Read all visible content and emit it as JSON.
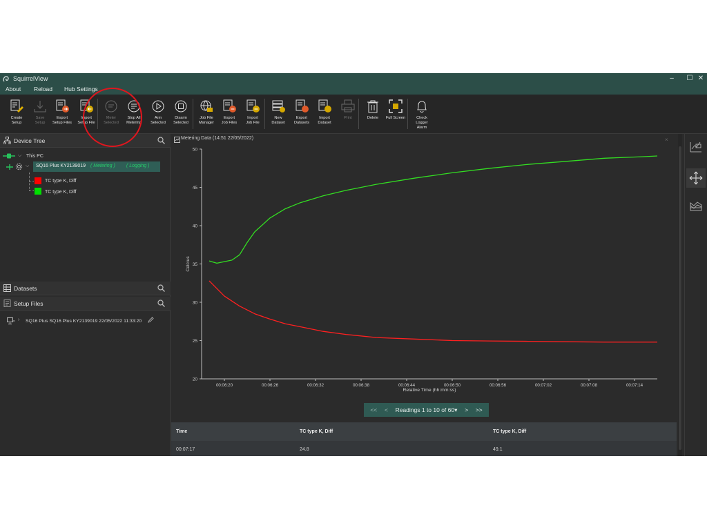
{
  "app": {
    "title": "SquirrelView"
  },
  "menu": [
    "About",
    "Reload",
    "Hub Settings"
  ],
  "toolbar": [
    {
      "l1": "Create",
      "l2": "Setup",
      "icon": "create-setup-icon",
      "enabled": true
    },
    {
      "l1": "Save",
      "l2": "Setup",
      "icon": "save-setup-icon",
      "enabled": false
    },
    {
      "l1": "Export",
      "l2": "Setup Files",
      "icon": "export-setup-files-icon",
      "enabled": true
    },
    {
      "l1": "Import",
      "l2": "Setup File",
      "icon": "import-setup-file-icon",
      "enabled": true
    },
    {
      "l1": "Meter",
      "l2": "Selected",
      "icon": "meter-selected-icon",
      "enabled": false
    },
    {
      "l1": "Stop All",
      "l2": "Metering",
      "icon": "stop-all-metering-icon",
      "enabled": true
    },
    {
      "l1": "Arm",
      "l2": "Selected",
      "icon": "arm-selected-icon",
      "enabled": true
    },
    {
      "l1": "Disarm",
      "l2": "Selected",
      "icon": "disarm-selected-icon",
      "enabled": true
    },
    {
      "l1": "Job File",
      "l2": "Manager",
      "icon": "job-file-manager-icon",
      "enabled": true
    },
    {
      "l1": "Export",
      "l2": "Job Files",
      "icon": "export-job-files-icon",
      "enabled": true
    },
    {
      "l1": "Import",
      "l2": "Job File",
      "icon": "import-job-file-icon",
      "enabled": true
    },
    {
      "l1": "New",
      "l2": "Dataset",
      "icon": "new-dataset-icon",
      "enabled": true
    },
    {
      "l1": "Export",
      "l2": "Datasets",
      "icon": "export-datasets-icon",
      "enabled": true
    },
    {
      "l1": "Import",
      "l2": "Dataset",
      "icon": "import-dataset-icon",
      "enabled": true
    },
    {
      "l1": "Print",
      "l2": "",
      "icon": "print-icon",
      "enabled": false
    },
    {
      "l1": "Delete",
      "l2": "",
      "icon": "delete-icon",
      "enabled": true
    },
    {
      "l1": "Full Screen",
      "l2": "",
      "icon": "full-screen-icon",
      "enabled": true
    },
    {
      "l1": "Check",
      "l2": "Logger",
      "l3": "Alarm",
      "icon": "bell-icon",
      "enabled": true
    }
  ],
  "left": {
    "device_tree_title": "Device Tree",
    "this_pc": "This PC",
    "device": "SQ16 Plus KY2139019",
    "status_metering": "( Metering )",
    "status_logging": "( Logging )",
    "channels": [
      {
        "label": "TC type K, Diff",
        "color": "#ff0000"
      },
      {
        "label": "TC type K, Diff",
        "color": "#00e000"
      }
    ],
    "datasets_title": "Datasets",
    "setup_files_title": "Setup Files",
    "setup_file_item": "SQ16 Plus SQ16 Plus KY2139019 22/05/2022 11:33:20"
  },
  "main": {
    "title": "Metering Data (14:51 22/05/2022)",
    "pager": {
      "first": "<<",
      "prev": "<",
      "label": "Readings 1 to 10 of 60",
      "next": ">",
      "last": ">>"
    },
    "table": {
      "headers": [
        "Time",
        "TC type K, Diff",
        "TC type K, Diff"
      ],
      "rows": [
        [
          "00:07:17",
          "24.8",
          "49.1"
        ]
      ]
    }
  },
  "chart_data": {
    "type": "line",
    "xlabel": "Relative Time (hh:mm:ss)",
    "ylabel": "Celcius",
    "ylim": [
      20,
      50
    ],
    "yticks": [
      20,
      25,
      30,
      35,
      40,
      45,
      50
    ],
    "xticks": [
      "00:06:20",
      "00:06:26",
      "00:06:32",
      "00:06:38",
      "00:06:44",
      "00:06:50",
      "00:06:56",
      "00:07:02",
      "00:07:08",
      "00:07:14"
    ],
    "xrange_seconds": [
      377,
      437
    ],
    "grid": false,
    "series": [
      {
        "color": "#ff2020",
        "x": [
          378,
          380,
          382,
          384,
          386,
          388,
          390,
          393,
          396,
          400,
          405,
          410,
          415,
          420,
          425,
          430,
          435,
          437
        ],
        "y": [
          32.8,
          30.8,
          29.5,
          28.5,
          27.8,
          27.2,
          26.8,
          26.2,
          25.8,
          25.4,
          25.2,
          25.0,
          24.95,
          24.9,
          24.85,
          24.8,
          24.8,
          24.8
        ]
      },
      {
        "color": "#33dd22",
        "x": [
          378,
          379,
          381,
          382,
          383,
          384,
          386,
          388,
          390,
          393,
          396,
          400,
          405,
          410,
          415,
          420,
          425,
          430,
          435,
          437
        ],
        "y": [
          35.4,
          35.1,
          35.5,
          36.2,
          37.8,
          39.2,
          41.0,
          42.2,
          43.0,
          43.9,
          44.6,
          45.4,
          46.2,
          46.9,
          47.5,
          48.0,
          48.4,
          48.8,
          49.0,
          49.1
        ]
      }
    ]
  },
  "colors": {
    "titlebar": "#2c4e48",
    "accent": "#2f5e56",
    "annotation": "#e0161e"
  }
}
